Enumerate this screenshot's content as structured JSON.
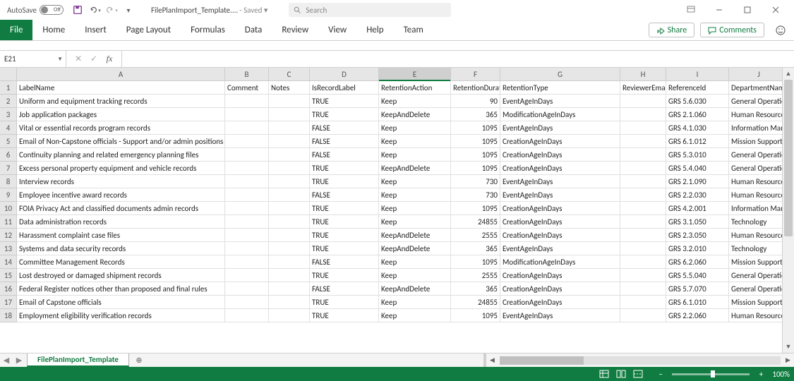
{
  "title_bar": {
    "autosave_label": "AutoSave",
    "autosave_off": "Off",
    "filename": "FilePlanImport_Template....",
    "saved_label": " - Saved ▾",
    "search_placeholder": "Search"
  },
  "ribbon": {
    "tabs": [
      "File",
      "Home",
      "Insert",
      "Page Layout",
      "Formulas",
      "Data",
      "Review",
      "View",
      "Help",
      "Team"
    ],
    "share_label": "Share",
    "comments_label": "Comments"
  },
  "formula_bar": {
    "name_box": "E21",
    "fx_label": "fx",
    "formula_value": ""
  },
  "grid": {
    "col_letters": [
      "A",
      "B",
      "C",
      "D",
      "E",
      "F",
      "G",
      "H",
      "I",
      "J"
    ],
    "headers": {
      "A": "LabelName",
      "B": "Comment",
      "C": "Notes",
      "D": "IsRecordLabel",
      "E": "RetentionAction",
      "F": "RetentionDuration",
      "G": "RetentionType",
      "H": "ReviewerEmail",
      "I": "ReferenceId",
      "J": "DepartmentName"
    },
    "rows": [
      {
        "A": "Uniform and equipment tracking records",
        "D": "TRUE",
        "E": "Keep",
        "F": "90",
        "G": "EventAgeInDays",
        "I": "GRS 5.6.030",
        "J": "General Operations"
      },
      {
        "A": "Job application packages",
        "D": "TRUE",
        "E": "KeepAndDelete",
        "F": "365",
        "G": "ModificationAgeInDays",
        "I": "GRS 2.1.060",
        "J": "Human Resources"
      },
      {
        "A": "Vital or essential records program records",
        "D": "FALSE",
        "E": "Keep",
        "F": "1095",
        "G": "EventAgeInDays",
        "I": "GRS 4.1.030",
        "J": "Information Management"
      },
      {
        "A": "Email of Non-Capstone officials - Support and/or admin positions",
        "D": "FALSE",
        "E": "Keep",
        "F": "1095",
        "G": "CreationAgeInDays",
        "I": "GRS 6.1.012",
        "J": "Mission Support"
      },
      {
        "A": "Continuity planning and related emergency planning files",
        "D": "FALSE",
        "E": "Keep",
        "F": "1095",
        "G": "CreationAgeInDays",
        "I": "GRS 5.3.010",
        "J": "General Operations"
      },
      {
        "A": "Excess personal property equipment and vehicle records",
        "D": "TRUE",
        "E": "KeepAndDelete",
        "F": "1095",
        "G": "CreationAgeInDays",
        "I": "GRS 5.4.040",
        "J": "General Operations"
      },
      {
        "A": "Interview records",
        "D": "TRUE",
        "E": "Keep",
        "F": "730",
        "G": "EventAgeInDays",
        "I": "GRS 2.1.090",
        "J": "Human Resources"
      },
      {
        "A": "Employee incentive award records",
        "D": "FALSE",
        "E": "Keep",
        "F": "730",
        "G": "EventAgeInDays",
        "I": "GRS 2.2.030",
        "J": "Human Resources"
      },
      {
        "A": "FOIA Privacy Act and classified documents admin records",
        "D": "TRUE",
        "E": "Keep",
        "F": "1095",
        "G": "CreationAgeInDays",
        "I": "GRS 4.2.001",
        "J": "Information Management"
      },
      {
        "A": "Data administration records",
        "D": "TRUE",
        "E": "Keep",
        "F": "24855",
        "G": "CreationAgeInDays",
        "I": "GRS 3.1.050",
        "J": "Technology"
      },
      {
        "A": "Harassment complaint case files",
        "D": "TRUE",
        "E": "KeepAndDelete",
        "F": "2555",
        "G": "CreationAgeInDays",
        "I": "GRS 2.3.050",
        "J": "Human Resources"
      },
      {
        "A": "Systems and data security records",
        "D": "TRUE",
        "E": "KeepAndDelete",
        "F": "365",
        "G": "EventAgeInDays",
        "I": "GRS 3.2.010",
        "J": "Technology"
      },
      {
        "A": "Committee Management Records",
        "D": "FALSE",
        "E": "Keep",
        "F": "1095",
        "G": "ModificationAgeInDays",
        "I": "GRS 6.2.060",
        "J": "Mission Support"
      },
      {
        "A": "Lost destroyed or damaged shipment records",
        "D": "TRUE",
        "E": "Keep",
        "F": "2555",
        "G": "CreationAgeInDays",
        "I": "GRS 5.5.040",
        "J": "General Operations"
      },
      {
        "A": "Federal Register notices other than proposed and final rules",
        "D": "FALSE",
        "E": "KeepAndDelete",
        "F": "365",
        "G": "CreationAgeInDays",
        "I": "GRS 5.7.070",
        "J": "General Operations"
      },
      {
        "A": "Email of Capstone officials",
        "D": "TRUE",
        "E": "Keep",
        "F": "24855",
        "G": "CreationAgeInDays",
        "I": "GRS 6.1.010",
        "J": "Mission Support"
      },
      {
        "A": "Employment eligibility verification records",
        "D": "TRUE",
        "E": "Keep",
        "F": "1095",
        "G": "EventAgeInDays",
        "I": "GRS 2.2.060",
        "J": "Human Resources"
      }
    ],
    "active_cell": "E21"
  },
  "sheet_bar": {
    "active_tab": "FilePlanImport_Template"
  },
  "status_bar": {
    "zoom_label": "100%"
  }
}
